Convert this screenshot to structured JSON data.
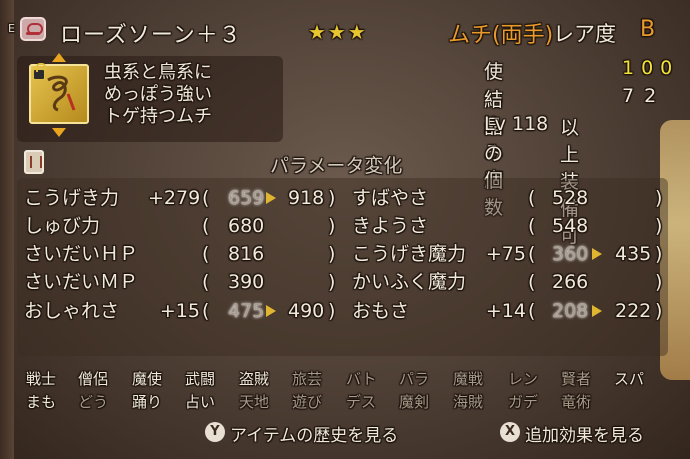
{
  "header": {
    "key_hint": "E",
    "item_name": "ローズソーン＋３",
    "stars": "★★★",
    "weapon_type": "ムチ(両手)",
    "rarity_label": "レア度",
    "rarity_value": "B"
  },
  "item": {
    "description_lines": [
      "虫系と鳥系に",
      "めっぽう強い",
      "トゲ持つムチ"
    ],
    "icon": "whip-icon"
  },
  "stats": {
    "usage_label": "使い込み度",
    "usage_value": "100",
    "crystal_label": "結晶の個数",
    "crystal_value": "72",
    "level_prefix": "Lv",
    "level_value": "118",
    "level_suffix": "以上装備可"
  },
  "params": {
    "title": "パラメータ変化",
    "left": [
      {
        "name": "こうげき力",
        "delta": "+279",
        "current": "659",
        "new": "918"
      },
      {
        "name": "しゅび力",
        "delta": "",
        "current": "680",
        "new": ""
      },
      {
        "name": "さいだいＨＰ",
        "delta": "",
        "current": "816",
        "new": ""
      },
      {
        "name": "さいだいＭＰ",
        "delta": "",
        "current": "390",
        "new": ""
      },
      {
        "name": "おしゃれさ",
        "delta": "+15",
        "current": "475",
        "new": "490"
      }
    ],
    "right": [
      {
        "name": "すばやさ",
        "delta": "",
        "current": "528",
        "new": ""
      },
      {
        "name": "きようさ",
        "delta": "",
        "current": "548",
        "new": ""
      },
      {
        "name": "こうげき魔力",
        "delta": "+75",
        "current": "360",
        "new": "435"
      },
      {
        "name": "かいふく魔力",
        "delta": "",
        "current": "266",
        "new": ""
      },
      {
        "name": "おもさ",
        "delta": "+14",
        "current": "208",
        "new": "222"
      }
    ],
    "paren_open": "(",
    "paren_close": ")"
  },
  "jobs": {
    "row1": [
      {
        "label": "戦士",
        "active": true
      },
      {
        "label": "僧侶",
        "active": true
      },
      {
        "label": "魔使",
        "active": true
      },
      {
        "label": "武闘",
        "active": true
      },
      {
        "label": "盗賊",
        "active": true
      },
      {
        "label": "旅芸",
        "active": false
      },
      {
        "label": "バト",
        "active": false
      },
      {
        "label": "パラ",
        "active": false
      },
      {
        "label": "魔戦",
        "active": false
      },
      {
        "label": "レン",
        "active": false
      },
      {
        "label": "賢者",
        "active": false
      },
      {
        "label": "スパ",
        "active": true
      }
    ],
    "row2": [
      {
        "label": "まも",
        "active": true
      },
      {
        "label": "どう",
        "active": false
      },
      {
        "label": "踊り",
        "active": true
      },
      {
        "label": "占い",
        "active": true
      },
      {
        "label": "天地",
        "active": false
      },
      {
        "label": "遊び",
        "active": false
      },
      {
        "label": "デス",
        "active": false
      },
      {
        "label": "魔剣",
        "active": false
      },
      {
        "label": "海賊",
        "active": false
      },
      {
        "label": "ガデ",
        "active": false
      },
      {
        "label": "竜術",
        "active": false
      }
    ]
  },
  "footer": {
    "y_button": "Y",
    "history_label": "アイテムの歴史を見る",
    "x_button": "X",
    "effect_label": "追加効果を見る"
  }
}
